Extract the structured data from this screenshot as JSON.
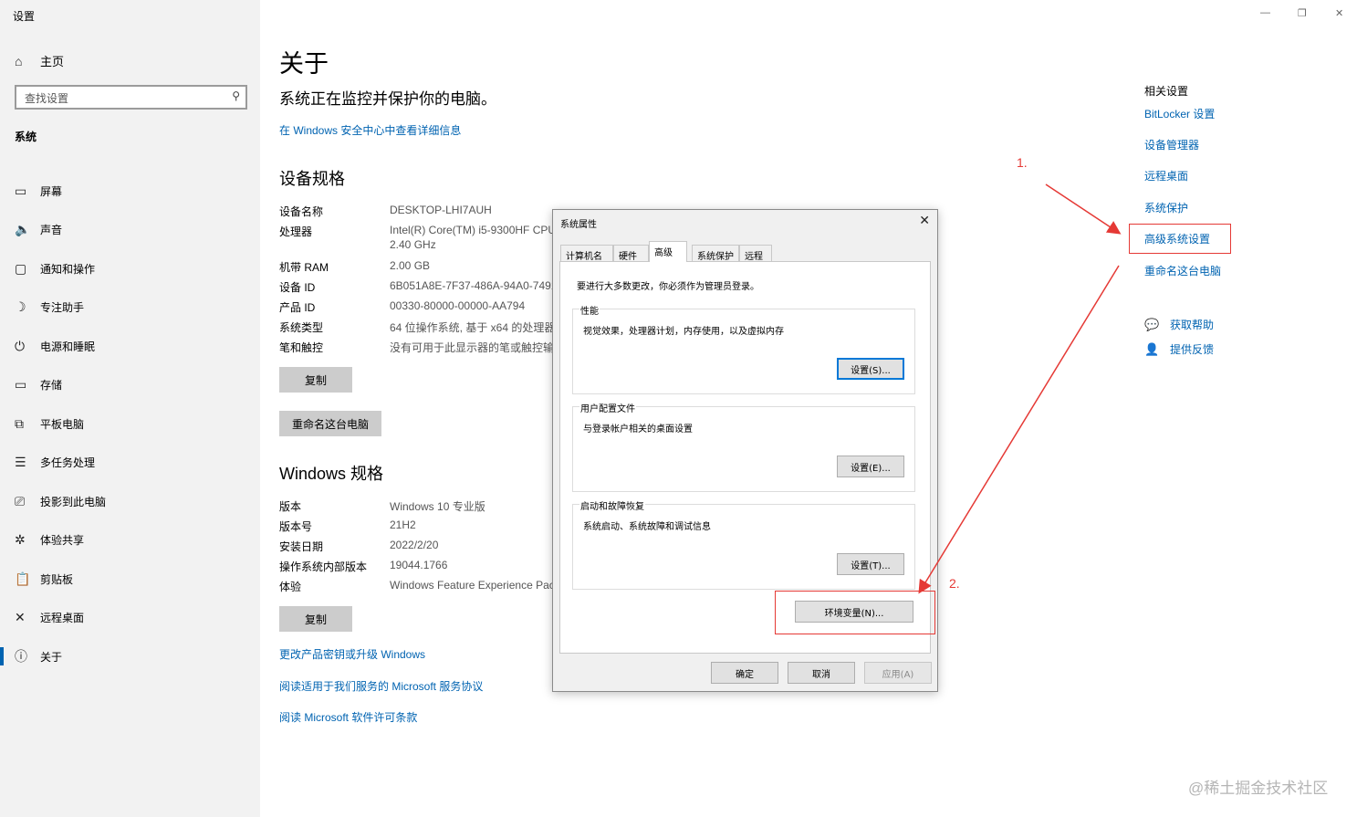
{
  "window": {
    "title": "设置",
    "controls": {
      "minimize": "—",
      "restore": "❐",
      "close": "✕"
    }
  },
  "sidebar": {
    "home": {
      "label": "主页",
      "icon": "home-icon"
    },
    "search": {
      "placeholder": "查找设置",
      "icon": "search-icon"
    },
    "section": "系统",
    "items": [
      {
        "label": "屏幕",
        "icon": "monitor-icon",
        "glyph": "▭"
      },
      {
        "label": "声音",
        "icon": "speaker-icon",
        "glyph": "🔈"
      },
      {
        "label": "通知和操作",
        "icon": "notification-icon",
        "glyph": "▢"
      },
      {
        "label": "专注助手",
        "icon": "moon-icon",
        "glyph": "☽"
      },
      {
        "label": "电源和睡眠",
        "icon": "power-icon",
        "glyph": "⏻"
      },
      {
        "label": "存储",
        "icon": "storage-icon",
        "glyph": "▭"
      },
      {
        "label": "平板电脑",
        "icon": "tablet-icon",
        "glyph": "⧉"
      },
      {
        "label": "多任务处理",
        "icon": "multitask-icon",
        "glyph": "☰"
      },
      {
        "label": "投影到此电脑",
        "icon": "project-icon",
        "glyph": "⎚"
      },
      {
        "label": "体验共享",
        "icon": "share-icon",
        "glyph": "✲"
      },
      {
        "label": "剪贴板",
        "icon": "clipboard-icon",
        "glyph": "📋"
      },
      {
        "label": "远程桌面",
        "icon": "remote-icon",
        "glyph": "✕"
      },
      {
        "label": "关于",
        "icon": "info-icon",
        "glyph": "ⓘ"
      }
    ]
  },
  "main": {
    "title": "关于",
    "subtitle": "系统正在监控并保护你的电脑。",
    "security_link": "在 Windows 安全中心中查看详细信息",
    "device_specs": {
      "heading": "设备规格",
      "rows": [
        {
          "key": "设备名称",
          "value": "DESKTOP-LHI7AUH"
        },
        {
          "key": "处理器",
          "value": "Intel(R) Core(TM) i5-9300HF CPU",
          "value2": "2.40 GHz"
        },
        {
          "key": "机带 RAM",
          "value": "2.00 GB"
        },
        {
          "key": "设备 ID",
          "value": "6B051A8E-7F37-486A-94A0-7491"
        },
        {
          "key": "产品 ID",
          "value": "00330-80000-00000-AA794"
        },
        {
          "key": "系统类型",
          "value": "64 位操作系统, 基于 x64 的处理器"
        },
        {
          "key": "笔和触控",
          "value": "没有可用于此显示器的笔或触控输入"
        }
      ],
      "copy_button": "复制",
      "rename_button": "重命名这台电脑"
    },
    "windows_specs": {
      "heading": "Windows 规格",
      "rows": [
        {
          "key": "版本",
          "value": "Windows 10 专业版"
        },
        {
          "key": "版本号",
          "value": "21H2"
        },
        {
          "key": "安装日期",
          "value": "2022/2/20"
        },
        {
          "key": "操作系统内部版本",
          "value": "19044.1766"
        },
        {
          "key": "体验",
          "value": "Windows Feature Experience Pack"
        }
      ],
      "copy_button": "复制"
    },
    "links": [
      "更改产品密钥或升级 Windows",
      "阅读适用于我们服务的 Microsoft 服务协议",
      "阅读 Microsoft 软件许可条款"
    ]
  },
  "related": {
    "title": "相关设置",
    "links": [
      "BitLocker 设置",
      "设备管理器",
      "远程桌面",
      "系统保护",
      "高级系统设置",
      "重命名这台电脑"
    ],
    "help": {
      "label": "获取帮助",
      "icon": "help-icon"
    },
    "feedback": {
      "label": "提供反馈",
      "icon": "feedback-icon"
    }
  },
  "dialog": {
    "title": "系统属性",
    "close": "✕",
    "tabs": [
      "计算机名",
      "硬件",
      "高级",
      "系统保护",
      "远程"
    ],
    "active_tab": "高级",
    "note": "要进行大多数更改，你必须作为管理员登录。",
    "groups": [
      {
        "label": "性能",
        "desc": "视觉效果，处理器计划，内存使用，以及虚拟内存",
        "button": "设置(S)..."
      },
      {
        "label": "用户配置文件",
        "desc": "与登录帐户相关的桌面设置",
        "button": "设置(E)..."
      },
      {
        "label": "启动和故障恢复",
        "desc": "系统启动、系统故障和调试信息",
        "button": "设置(T)..."
      }
    ],
    "env_button": "环境变量(N)...",
    "ok": "确定",
    "cancel": "取消",
    "apply": "应用(A)"
  },
  "annotations": {
    "step1": "1.",
    "step2": "2.",
    "color": "#e53935"
  },
  "watermark": "@稀土掘金技术社区",
  "colors": {
    "accent": "#0063b1",
    "sidebar_bg": "#f2f2f2",
    "dialog_bg": "#f0f0f0"
  }
}
